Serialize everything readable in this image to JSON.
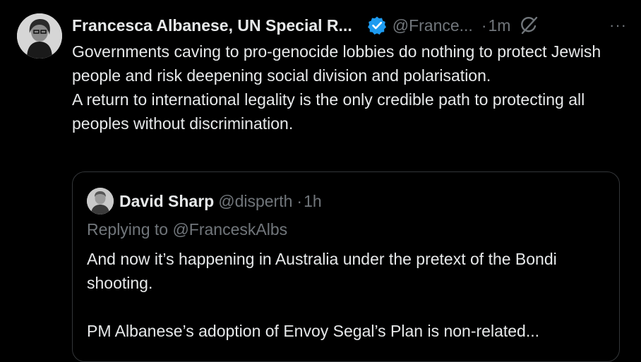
{
  "post": {
    "author_name": "Francesca Albanese, UN Special R...",
    "handle": "@France...",
    "separator": "·",
    "time": "1m",
    "more_label": "···",
    "text_lines": [
      "Governments caving to pro-genocide lobbies do nothing to protect Jewish people and risk deepening social division and polarisation.",
      "A return to international legality is the only credible path to protecting all peoples without discrimination."
    ],
    "verified_color": "#1d9bf0"
  },
  "quote": {
    "author_name": "David Sharp",
    "handle": "@disperth",
    "separator": "·",
    "time": "1h",
    "replying_to": "Replying to @FranceskAlbs",
    "paragraphs": [
      "And now it’s happening in Australia under the pretext of the Bondi shooting.",
      "PM Albanese’s adoption of Envoy Segal’s Plan is non-related..."
    ]
  },
  "colors": {
    "background": "#000000",
    "text": "#e7e9ea",
    "muted": "#71767b",
    "border": "#333639"
  }
}
